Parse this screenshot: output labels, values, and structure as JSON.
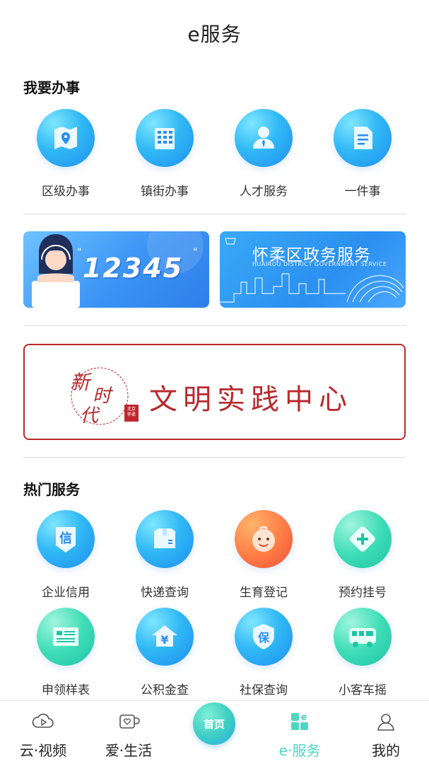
{
  "header": {
    "title": "e服务"
  },
  "section_office": {
    "title": "我要办事",
    "items": [
      {
        "label": "区级办事",
        "icon": "map-icon"
      },
      {
        "label": "镇街办事",
        "icon": "building-icon"
      },
      {
        "label": "人才服务",
        "icon": "person-icon"
      },
      {
        "label": "一件事",
        "icon": "document-icon"
      }
    ]
  },
  "banners": {
    "hotline": {
      "number": "12345"
    },
    "gov": {
      "title": "怀柔区政务服务",
      "subtitle": "HUAIROU DISTRICT GOVERNMENT SERVICE"
    },
    "civil": {
      "calligraphy": "新时代",
      "seal": "北京怀柔",
      "title": "文明实践中心"
    }
  },
  "section_hot": {
    "title": "热门服务",
    "items": [
      {
        "label": "企业信用",
        "icon": "credit-icon",
        "glyph": "信"
      },
      {
        "label": "快递查询",
        "icon": "package-icon"
      },
      {
        "label": "生育登记",
        "icon": "baby-icon"
      },
      {
        "label": "预约挂号",
        "icon": "medical-plus-icon"
      },
      {
        "label": "申领样表",
        "icon": "form-icon"
      },
      {
        "label": "公积金查",
        "icon": "housing-fund-icon",
        "glyph": "¥"
      },
      {
        "label": "社保查询",
        "icon": "social-security-icon",
        "glyph": "保"
      },
      {
        "label": "小客车摇",
        "icon": "bus-icon"
      }
    ]
  },
  "tabbar": {
    "tabs": [
      {
        "label": "云·视频",
        "icon": "cloud-video-icon"
      },
      {
        "label": "爱·生活",
        "icon": "mug-heart-icon"
      },
      {
        "label": "首页",
        "icon": "home-icon"
      },
      {
        "label": "e·服务",
        "icon": "grid-e-icon",
        "active": true
      },
      {
        "label": "我的",
        "icon": "user-icon"
      }
    ]
  },
  "colors": {
    "accent_teal": "#4fd6c2",
    "civil_red": "#b82a2e",
    "icon_blue": "#31b9f5"
  }
}
